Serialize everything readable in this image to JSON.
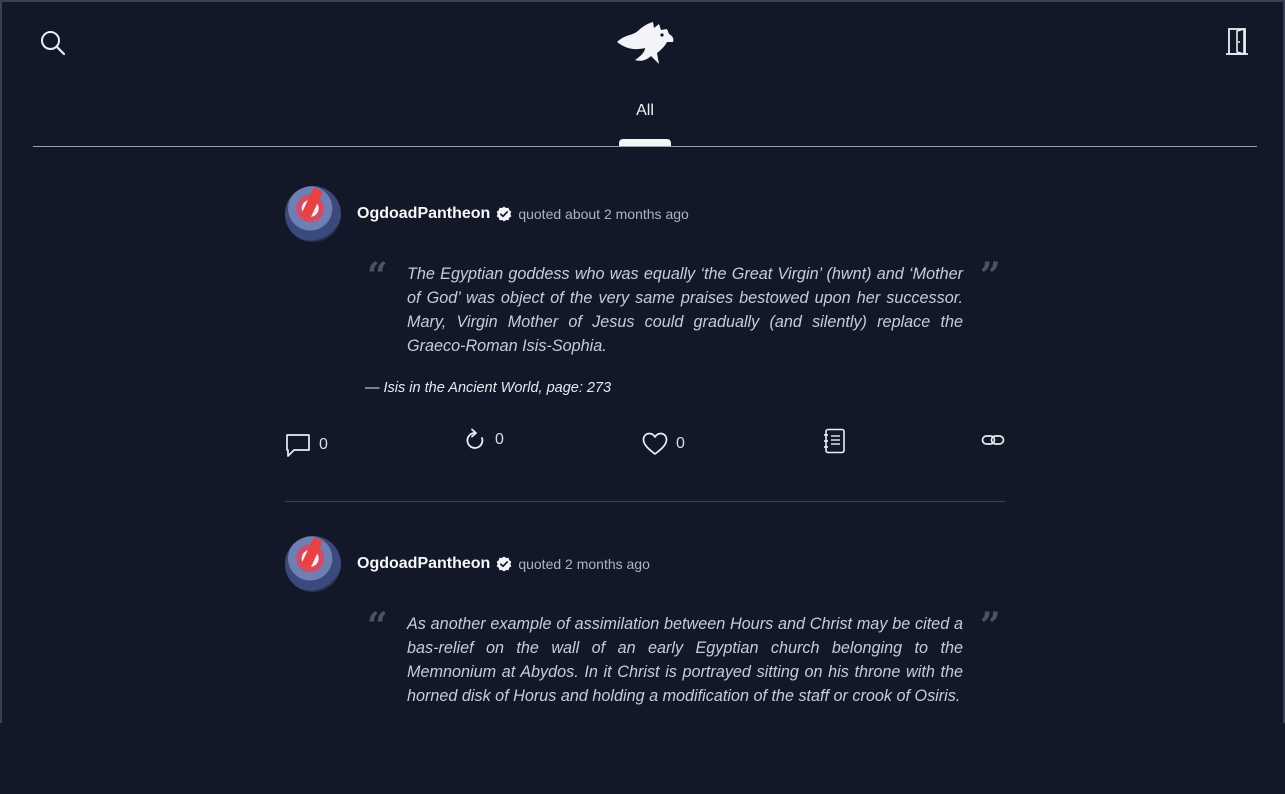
{
  "topbar": {
    "search_icon": "search-icon",
    "logo_icon": "eagle-logo-icon",
    "logout_icon": "door-icon"
  },
  "tabs": [
    {
      "label": "All",
      "active": true
    }
  ],
  "posts": [
    {
      "author": "OgdoadPantheon",
      "verified": true,
      "meta": "quoted about 2 months ago",
      "quote": "The Egyptian goddess who was equally ‘the Great Virgin’ (hwnt) and ‘Mother of God’ was object of the very same praises bestowed upon her successor. Mary, Virgin Mother of Jesus could gradually (and silently) replace the Graeco-Roman Isis-Sophia.",
      "source": "— Isis in the Ancient World, page: 273",
      "actions": {
        "comments": "0",
        "reposts": "0",
        "likes": "0"
      }
    },
    {
      "author": "OgdoadPantheon",
      "verified": true,
      "meta": "quoted 2 months ago",
      "quote": "As another example of assimilation between Hours and Christ may be cited a bas-relief on the wall of an early Egyptian church belonging to the Memnonium at Abydos. In it Christ is portrayed sitting on his throne with the horned disk of Horus and holding a modification of the staff or crook of Osiris."
    }
  ],
  "colors": {
    "background": "#131829",
    "text": "#f6f7f9",
    "muted": "#aeb3bf",
    "divider": "#3c4252"
  }
}
